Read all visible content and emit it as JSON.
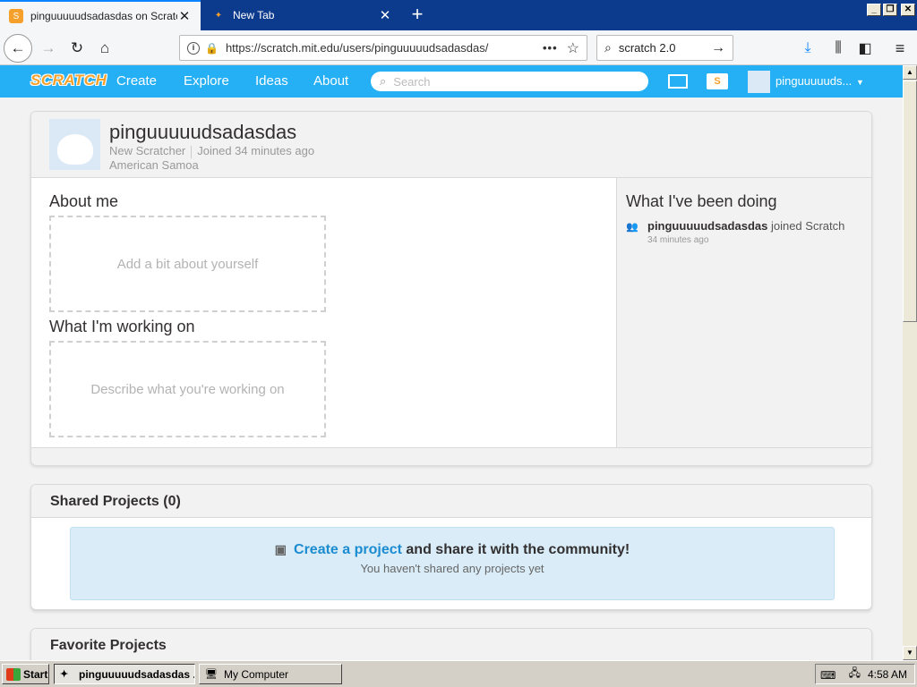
{
  "browser": {
    "tabs": [
      {
        "title": "pinguuuuudsadasdas on Scratch",
        "favicon": "scratch-s",
        "active": true
      },
      {
        "title": "New Tab",
        "favicon": "firefox",
        "active": false
      }
    ],
    "url": "https://scratch.mit.edu/users/pinguuuuudsadasdas/",
    "search_value": "scratch 2.0",
    "accent": "#0a84ff"
  },
  "scratch": {
    "logo": "SCRATCH",
    "nav": {
      "create": "Create",
      "explore": "Explore",
      "ideas": "Ideas",
      "about": "About"
    },
    "search_placeholder": "Search",
    "username_short": "pinguuuuuds...",
    "brand_color": "#25aff4"
  },
  "profile": {
    "username": "pinguuuuudsadasdas",
    "status": "New Scratcher",
    "joined": "Joined 34 minutes ago",
    "location": "American Samoa",
    "about_heading": "About me",
    "about_placeholder": "Add a bit about yourself",
    "working_heading": "What I'm working on",
    "working_placeholder": "Describe what you're working on",
    "doing_heading": "What I've been doing",
    "activity": {
      "user": "pinguuuuudsadasdas",
      "action": "joined Scratch",
      "time": "34 minutes ago"
    }
  },
  "shared": {
    "heading": "Shared Projects (0)",
    "link": "Create a project",
    "rest": "and share it with the community!",
    "sub": "You haven't shared any projects yet"
  },
  "favorites": {
    "heading": "Favorite Projects"
  },
  "taskbar": {
    "start": "Start",
    "windows": [
      "pinguuuuudsadasdas ...",
      "My Computer"
    ],
    "clock": "4:58 AM"
  }
}
